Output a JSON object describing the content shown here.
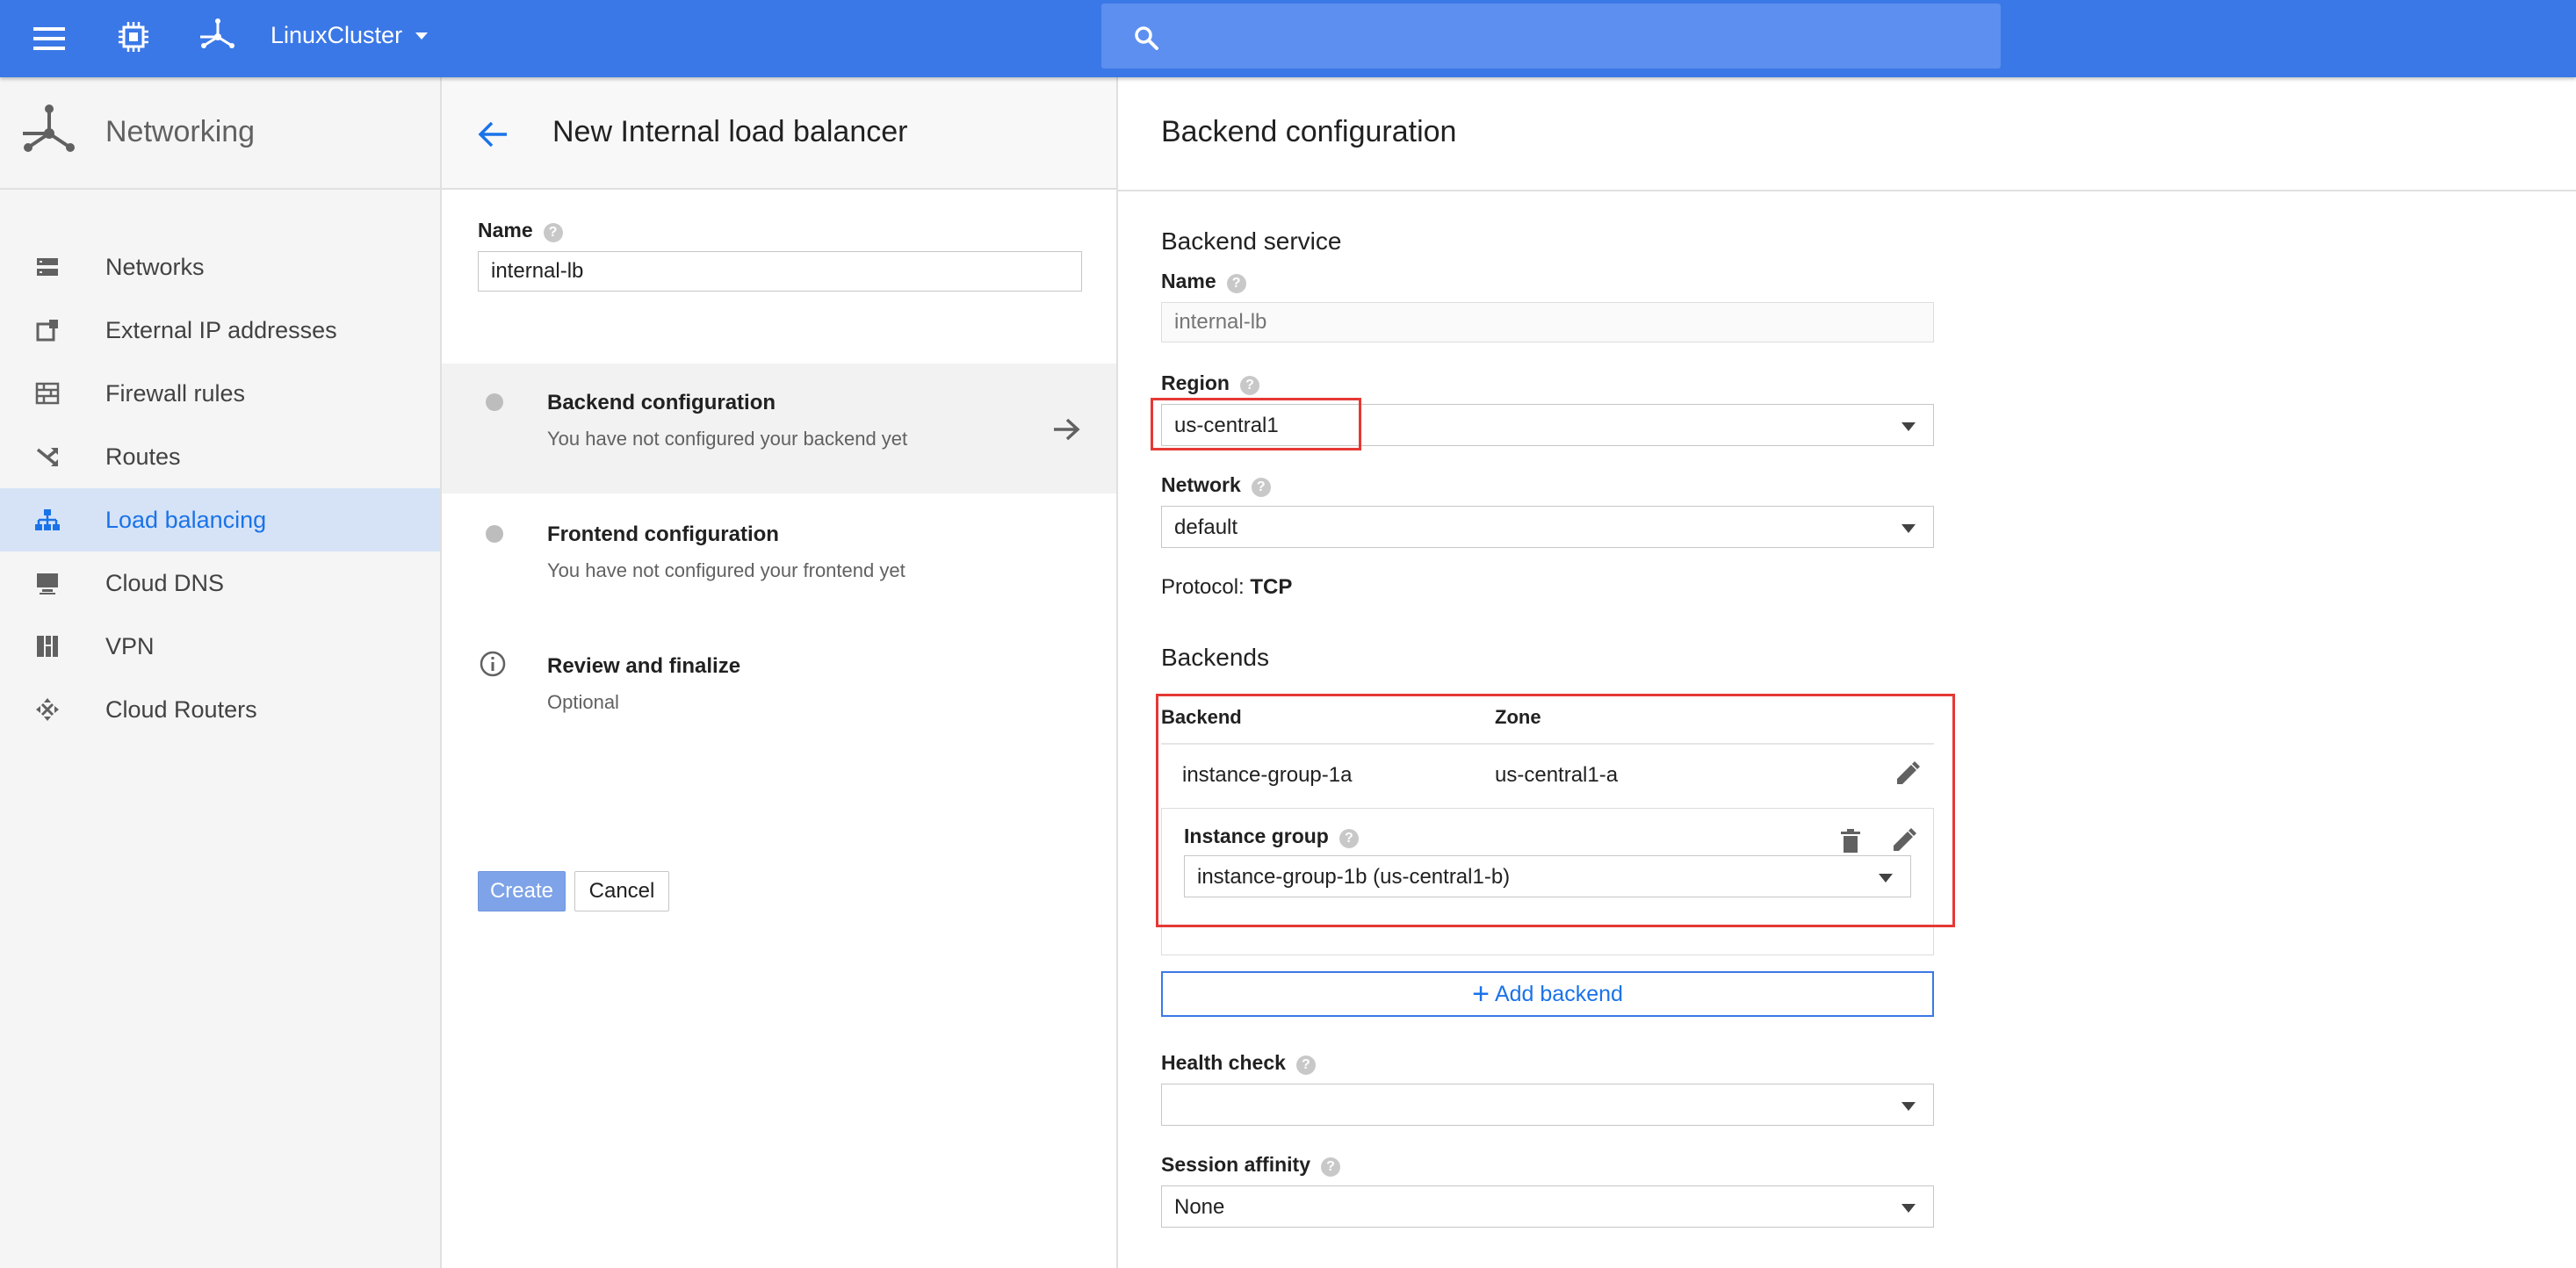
{
  "topbar": {
    "project_name": "LinuxCluster",
    "search_value": "",
    "colors": {
      "bar": "#3b78e7",
      "search": "#5c8ff0"
    }
  },
  "sidebar": {
    "title": "Networking",
    "items": [
      {
        "label": "Networks",
        "icon": "networks-icon"
      },
      {
        "label": "External IP addresses",
        "icon": "external-ip-icon"
      },
      {
        "label": "Firewall rules",
        "icon": "firewall-icon"
      },
      {
        "label": "Routes",
        "icon": "routes-icon"
      },
      {
        "label": "Load balancing",
        "icon": "load-balancing-icon",
        "active": true
      },
      {
        "label": "Cloud DNS",
        "icon": "cloud-dns-icon"
      },
      {
        "label": "VPN",
        "icon": "vpn-icon"
      },
      {
        "label": "Cloud Routers",
        "icon": "cloud-routers-icon"
      }
    ]
  },
  "wizard": {
    "title": "New Internal load balancer",
    "name_label": "Name",
    "name_value": "internal-lb",
    "steps": [
      {
        "title": "Backend configuration",
        "subtitle": "You have not configured your backend yet"
      },
      {
        "title": "Frontend configuration",
        "subtitle": "You have not configured your frontend yet"
      },
      {
        "title": "Review and finalize",
        "subtitle": "Optional"
      }
    ],
    "create_label": "Create",
    "cancel_label": "Cancel"
  },
  "backend": {
    "title": "Backend configuration",
    "service_title": "Backend service",
    "name_label": "Name",
    "name_placeholder": "internal-lb",
    "region_label": "Region",
    "region_value": "us-central1",
    "network_label": "Network",
    "network_value": "default",
    "protocol_label": "Protocol:",
    "protocol_value": "TCP",
    "backends_title": "Backends",
    "col_backend": "Backend",
    "col_zone": "Zone",
    "rows": [
      {
        "backend": "instance-group-1a",
        "zone": "us-central1-a"
      }
    ],
    "instance_group_label": "Instance group",
    "instance_group_value": "instance-group-1b (us-central1-b)",
    "add_backend_label": "Add backend",
    "health_check_label": "Health check",
    "health_check_value": "",
    "session_affinity_label": "Session affinity",
    "session_affinity_value": "None"
  }
}
